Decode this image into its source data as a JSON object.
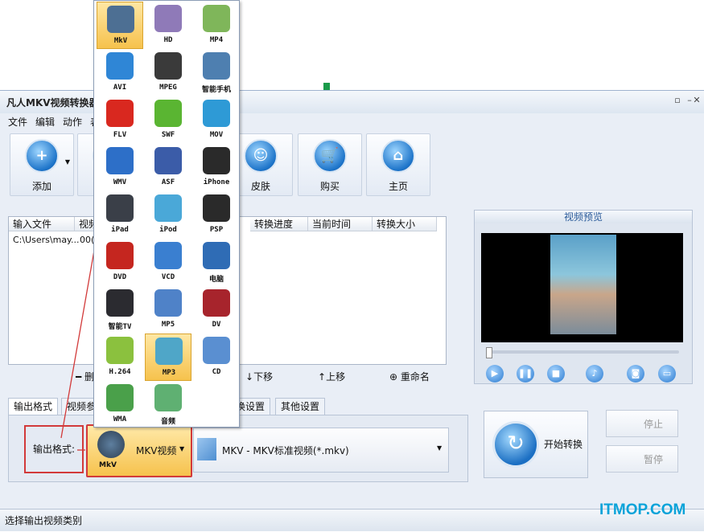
{
  "window": {
    "title": "凡人MKV视频转换器",
    "controls": [
      "▫",
      "–",
      "✕"
    ]
  },
  "menu": [
    "文件",
    "编辑",
    "动作",
    "表"
  ],
  "toolbar": [
    {
      "label": "添加",
      "glyph": "+"
    },
    {
      "label": "",
      "glyph": ""
    },
    {
      "label": "皮肤",
      "glyph": "☺"
    },
    {
      "label": "购买",
      "glyph": "🛒"
    },
    {
      "label": "主页",
      "glyph": "⌂"
    }
  ],
  "filelist": {
    "headers": [
      "输入文件",
      "视频",
      "转换进度",
      "当前时间",
      "转换大小"
    ],
    "rows": [
      [
        "C:\\Users\\may...",
        "00("
      ]
    ]
  },
  "list_actions": {
    "delete": "删",
    "down": "下移",
    "up": "上移",
    "rename": "重命名"
  },
  "preview": {
    "title": "视频预览"
  },
  "tabs": [
    "输出格式",
    "视频参",
    "换设置",
    "其他设置"
  ],
  "output": {
    "label": "输出格式:",
    "format_button": "MKV视频",
    "format_icon_caption": "MkV",
    "format_select": "MKV - MKV标准视频(*.mkv)"
  },
  "actions": {
    "start": "开始转换",
    "stop": "停止",
    "pause": "暂停"
  },
  "status": "选择输出视频类别",
  "watermark": "ITMOP.COM",
  "formats": [
    {
      "name": "MkV",
      "color": "#4d6f93",
      "selected": true
    },
    {
      "name": "HD",
      "color": "#8f7ab8"
    },
    {
      "name": "MP4",
      "color": "#7fb65a"
    },
    {
      "name": "AVI",
      "color": "#2f86d6"
    },
    {
      "name": "MPEG",
      "color": "#3a3a3a"
    },
    {
      "name": "智能手机",
      "color": "#4e7fb0"
    },
    {
      "name": "FLV",
      "color": "#d9281f"
    },
    {
      "name": "SWF",
      "color": "#5ab532"
    },
    {
      "name": "MOV",
      "color": "#2e9ad6"
    },
    {
      "name": "WMV",
      "color": "#2d6fc8"
    },
    {
      "name": "ASF",
      "color": "#3b5ca8"
    },
    {
      "name": "iPhone",
      "color": "#2a2a2a"
    },
    {
      "name": "iPad",
      "color": "#3a3f48"
    },
    {
      "name": "iPod",
      "color": "#4aa8d8"
    },
    {
      "name": "PSP",
      "color": "#2a2a2a"
    },
    {
      "name": "DVD",
      "color": "#c5261f"
    },
    {
      "name": "VCD",
      "color": "#3a7fd0"
    },
    {
      "name": "电脑",
      "color": "#2f6cb5"
    },
    {
      "name": "智能TV",
      "color": "#2b2b30"
    },
    {
      "name": "MP5",
      "color": "#4f82c8"
    },
    {
      "name": "DV",
      "color": "#a7242c"
    },
    {
      "name": "H.264",
      "color": "#8bc13e"
    },
    {
      "name": "MP3",
      "color": "#4fa6c8",
      "selected": true
    },
    {
      "name": "CD",
      "color": "#5a8fd1"
    },
    {
      "name": "WMA",
      "color": "#4aa04a"
    },
    {
      "name": "音频",
      "color": "#5fb072"
    }
  ]
}
